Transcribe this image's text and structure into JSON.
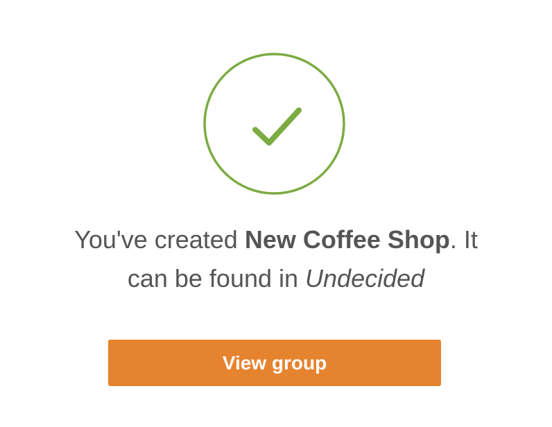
{
  "icon": {
    "name": "checkmark-circle-icon",
    "color": "#7cab42"
  },
  "message": {
    "prefix": "You've created ",
    "group_name": "New Coffee Shop",
    "middle": ". It can be found in ",
    "folder_name": "Undecided"
  },
  "button": {
    "label": "View group",
    "color": "#e6832f"
  }
}
